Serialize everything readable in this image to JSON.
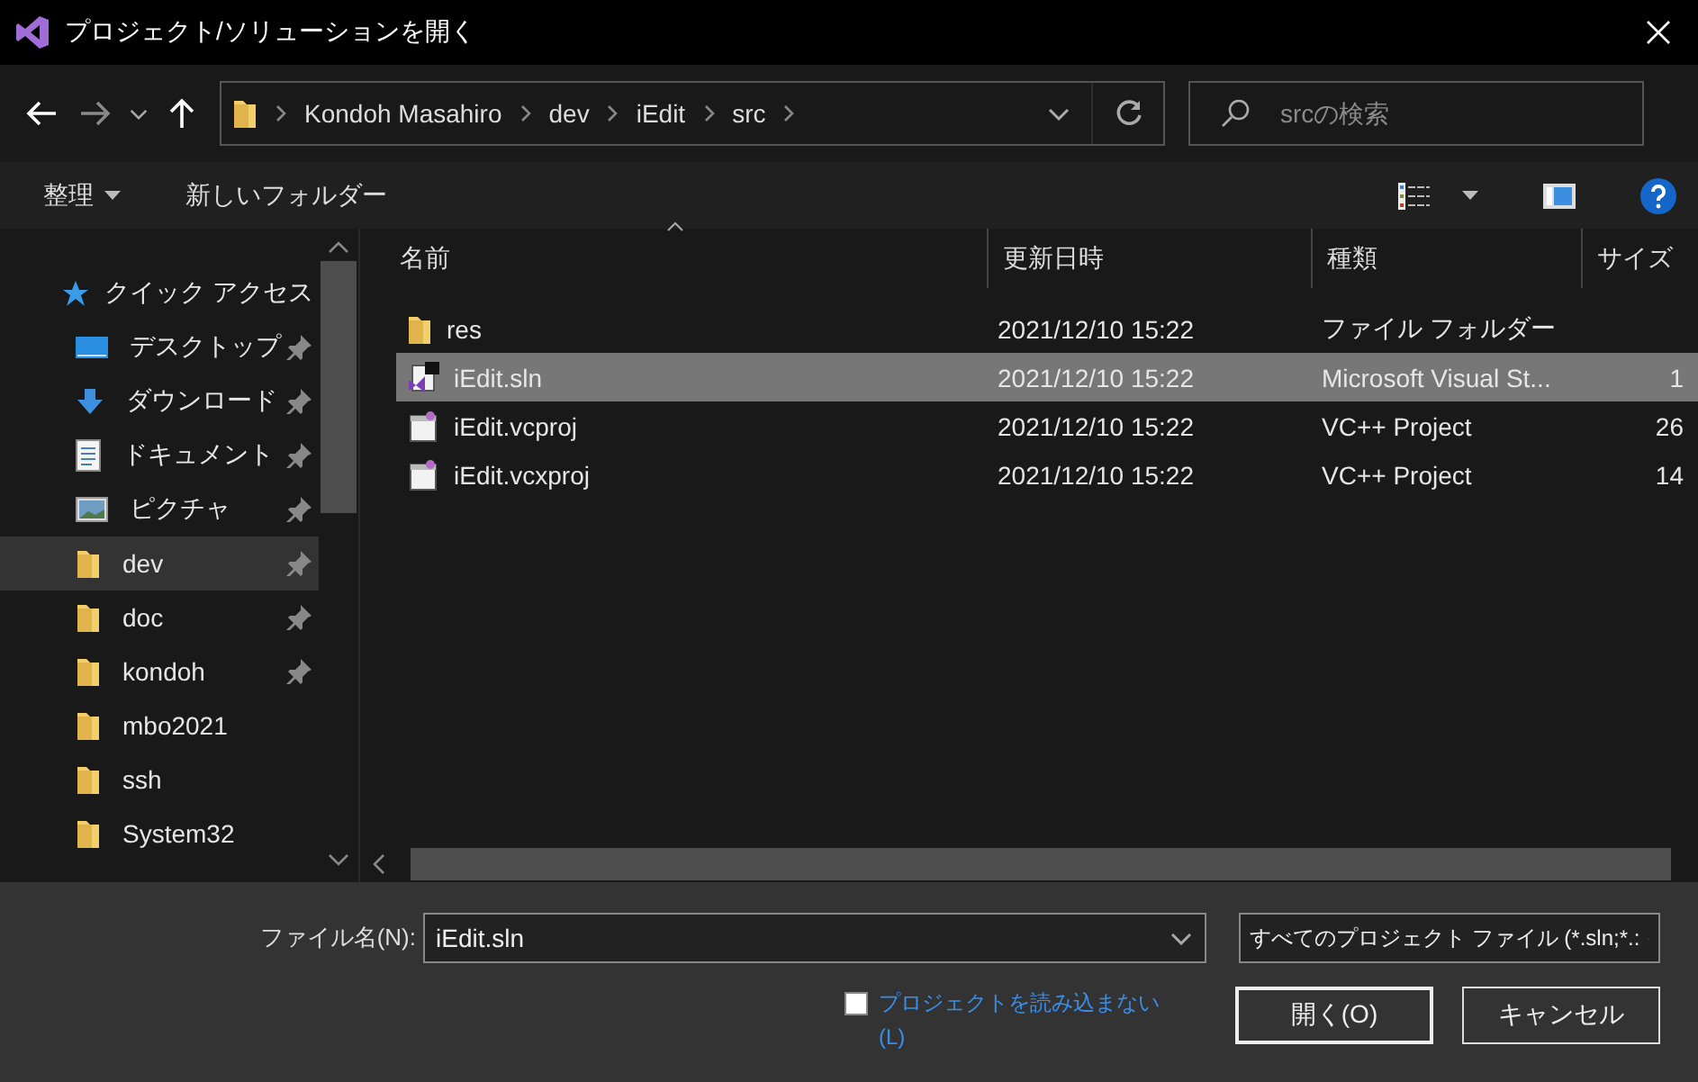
{
  "window": {
    "title": "プロジェクト/ソリューションを開く"
  },
  "address": {
    "crumbs": [
      "Kondoh Masahiro",
      "dev",
      "iEdit",
      "src"
    ]
  },
  "search": {
    "placeholder": "srcの検索"
  },
  "toolbar": {
    "organize": "整理",
    "new_folder": "新しいフォルダー"
  },
  "sidebar": {
    "items": [
      {
        "label": "クイック アクセス",
        "kind": "star",
        "pinned": false,
        "selected": false
      },
      {
        "label": "デスクトップ",
        "kind": "desktop",
        "pinned": true,
        "selected": false
      },
      {
        "label": "ダウンロード",
        "kind": "download",
        "pinned": true,
        "selected": false
      },
      {
        "label": "ドキュメント",
        "kind": "document",
        "pinned": true,
        "selected": false
      },
      {
        "label": "ピクチャ",
        "kind": "pictures",
        "pinned": true,
        "selected": false
      },
      {
        "label": "dev",
        "kind": "folder",
        "pinned": true,
        "selected": true
      },
      {
        "label": "doc",
        "kind": "folder",
        "pinned": true,
        "selected": false
      },
      {
        "label": "kondoh",
        "kind": "folder",
        "pinned": true,
        "selected": false
      },
      {
        "label": "mbo2021",
        "kind": "folder",
        "pinned": false,
        "selected": false
      },
      {
        "label": "ssh",
        "kind": "folder",
        "pinned": false,
        "selected": false
      },
      {
        "label": "System32",
        "kind": "folder",
        "pinned": false,
        "selected": false
      }
    ]
  },
  "table": {
    "columns": [
      "名前",
      "更新日時",
      "種類",
      "サイズ"
    ],
    "rows": [
      {
        "kind": "folder",
        "name": "res",
        "date": "2021/12/10 15:22",
        "type": "ファイル フォルダー",
        "size": "",
        "selected": false
      },
      {
        "kind": "solution",
        "name": "iEdit.sln",
        "date": "2021/12/10 15:22",
        "type": "Microsoft Visual St...",
        "size": "1",
        "selected": true
      },
      {
        "kind": "project",
        "name": "iEdit.vcproj",
        "date": "2021/12/10 15:22",
        "type": "VC++ Project",
        "size": "26",
        "selected": false
      },
      {
        "kind": "project",
        "name": "iEdit.vcxproj",
        "date": "2021/12/10 15:22",
        "type": "VC++ Project",
        "size": "14",
        "selected": false
      }
    ]
  },
  "footer": {
    "filename_label": "ファイル名(N):",
    "filename": "iEdit.sln",
    "filter": "すべてのプロジェクト ファイル (*.sln;*.:",
    "no_load": {
      "label": "プロジェクトを読み込まない(L)",
      "checked": false
    },
    "buttons": [
      "開く(O)",
      "キャンセル"
    ]
  }
}
